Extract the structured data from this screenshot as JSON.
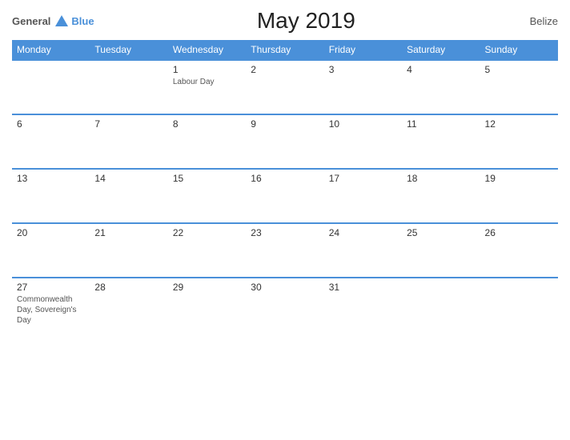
{
  "header": {
    "logo_general": "General",
    "logo_blue": "Blue",
    "title": "May 2019",
    "country": "Belize"
  },
  "calendar": {
    "weekdays": [
      "Monday",
      "Tuesday",
      "Wednesday",
      "Thursday",
      "Friday",
      "Saturday",
      "Sunday"
    ],
    "weeks": [
      [
        {
          "day": "",
          "holiday": "",
          "empty": true
        },
        {
          "day": "",
          "holiday": "",
          "empty": true
        },
        {
          "day": "1",
          "holiday": "Labour Day",
          "empty": false
        },
        {
          "day": "2",
          "holiday": "",
          "empty": false
        },
        {
          "day": "3",
          "holiday": "",
          "empty": false
        },
        {
          "day": "4",
          "holiday": "",
          "empty": false
        },
        {
          "day": "5",
          "holiday": "",
          "empty": false
        }
      ],
      [
        {
          "day": "6",
          "holiday": "",
          "empty": false
        },
        {
          "day": "7",
          "holiday": "",
          "empty": false
        },
        {
          "day": "8",
          "holiday": "",
          "empty": false
        },
        {
          "day": "9",
          "holiday": "",
          "empty": false
        },
        {
          "day": "10",
          "holiday": "",
          "empty": false
        },
        {
          "day": "11",
          "holiday": "",
          "empty": false
        },
        {
          "day": "12",
          "holiday": "",
          "empty": false
        }
      ],
      [
        {
          "day": "13",
          "holiday": "",
          "empty": false
        },
        {
          "day": "14",
          "holiday": "",
          "empty": false
        },
        {
          "day": "15",
          "holiday": "",
          "empty": false
        },
        {
          "day": "16",
          "holiday": "",
          "empty": false
        },
        {
          "day": "17",
          "holiday": "",
          "empty": false
        },
        {
          "day": "18",
          "holiday": "",
          "empty": false
        },
        {
          "day": "19",
          "holiday": "",
          "empty": false
        }
      ],
      [
        {
          "day": "20",
          "holiday": "",
          "empty": false
        },
        {
          "day": "21",
          "holiday": "",
          "empty": false
        },
        {
          "day": "22",
          "holiday": "",
          "empty": false
        },
        {
          "day": "23",
          "holiday": "",
          "empty": false
        },
        {
          "day": "24",
          "holiday": "",
          "empty": false
        },
        {
          "day": "25",
          "holiday": "",
          "empty": false
        },
        {
          "day": "26",
          "holiday": "",
          "empty": false
        }
      ],
      [
        {
          "day": "27",
          "holiday": "Commonwealth Day, Sovereign's Day",
          "empty": false
        },
        {
          "day": "28",
          "holiday": "",
          "empty": false
        },
        {
          "day": "29",
          "holiday": "",
          "empty": false
        },
        {
          "day": "30",
          "holiday": "",
          "empty": false
        },
        {
          "day": "31",
          "holiday": "",
          "empty": false
        },
        {
          "day": "",
          "holiday": "",
          "empty": true
        },
        {
          "day": "",
          "holiday": "",
          "empty": true
        }
      ]
    ]
  }
}
